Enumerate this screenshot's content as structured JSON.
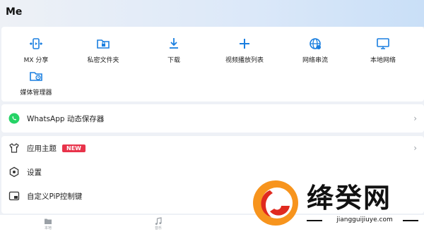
{
  "header": {
    "title": "Me"
  },
  "grid": [
    {
      "label": "MX 分享",
      "icon": "share-video-icon"
    },
    {
      "label": "私密文件夹",
      "icon": "private-folder-icon"
    },
    {
      "label": "下载",
      "icon": "download-icon"
    },
    {
      "label": "视频播放列表",
      "icon": "add-icon"
    },
    {
      "label": "网络串流",
      "icon": "network-stream-icon"
    },
    {
      "label": "本地网络",
      "icon": "monitor-icon"
    },
    {
      "label": "媒体管理器",
      "icon": "media-manager-icon"
    }
  ],
  "rows": {
    "whatsapp": {
      "label": "WhatsApp 动态保存器",
      "icon": "whatsapp-icon"
    },
    "theme": {
      "label": "应用主题",
      "badge": "NEW",
      "icon": "shirt-icon"
    },
    "settings": {
      "label": "设置",
      "icon": "settings-icon"
    },
    "pip": {
      "label": "自定义PiP控制键",
      "icon": "pip-icon"
    }
  },
  "chevron": "›",
  "bottom_nav": [
    {
      "label": "本地",
      "icon": "folder-icon"
    },
    {
      "label": "音乐",
      "icon": "music-icon"
    }
  ],
  "watermark": {
    "brand": "绛癸网",
    "url": "jiangguijiuye.com"
  },
  "colors": {
    "accent": "#1a7fe0",
    "badge": "#e8334a",
    "whatsapp": "#25d366"
  }
}
